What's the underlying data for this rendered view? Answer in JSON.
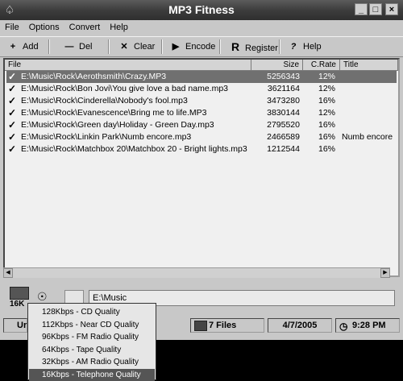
{
  "window": {
    "title": "MP3 Fitness"
  },
  "menu": [
    "File",
    "Options",
    "Convert",
    "Help"
  ],
  "toolbar": {
    "add": "Add",
    "del": "Del",
    "clear": "Clear",
    "encode": "Encode",
    "register": "Register",
    "help": "Help"
  },
  "columns": {
    "file": "File",
    "size": "Size",
    "rate": "C.Rate",
    "title": "Title"
  },
  "rows": [
    {
      "file": "E:\\Music\\Rock\\Aerothsmith\\Crazy.MP3",
      "size": "5256343",
      "rate": "12%",
      "title": ""
    },
    {
      "file": "E:\\Music\\Rock\\Bon Jovi\\You give love a bad name.mp3",
      "size": "3621164",
      "rate": "12%",
      "title": ""
    },
    {
      "file": "E:\\Music\\Rock\\Cinderella\\Nobody's fool.mp3",
      "size": "3473280",
      "rate": "16%",
      "title": ""
    },
    {
      "file": "E:\\Music\\Rock\\Evanescence\\Bring me to life.MP3",
      "size": "3830144",
      "rate": "12%",
      "title": ""
    },
    {
      "file": "E:\\Music\\Rock\\Green day\\Holiday - Green Day.mp3",
      "size": "2795520",
      "rate": "16%",
      "title": ""
    },
    {
      "file": "E:\\Music\\Rock\\Linkin Park\\Numb encore.mp3",
      "size": "2466589",
      "rate": "16%",
      "title": "Numb encore"
    },
    {
      "file": "E:\\Music\\Rock\\Matchbox 20\\Matchbox 20 - Bright lights.mp3",
      "size": "1212544",
      "rate": "16%",
      "title": ""
    }
  ],
  "bottom": {
    "folder": "E:\\Music",
    "quality_label": "16K"
  },
  "status": {
    "left": "Ur",
    "files": "7 Files",
    "date": "4/7/2005",
    "time": "9:28 PM"
  },
  "quality_menu": [
    "128Kbps - CD Quality",
    "112Kbps - Near CD Quality",
    "96Kbps - FM Radio Quality",
    "64Kbps - Tape Quality",
    "32Kbps - AM Radio Quality",
    "16Kbps - Telephone Quality"
  ],
  "quality_menu_selected": "16Kbps - Telephone Quality"
}
